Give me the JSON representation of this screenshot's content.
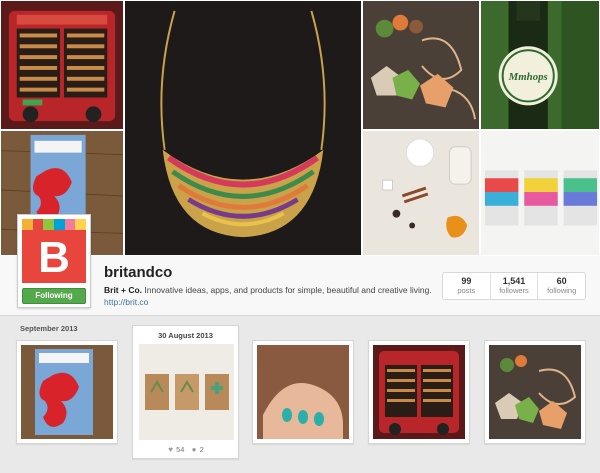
{
  "profile": {
    "username": "britandco",
    "verified_mark": "▫",
    "bio_name": "Brit + Co.",
    "bio_text": " Innovative ideas, apps, and products for simple, beautiful and creative living.",
    "link": "http://brit.co",
    "follow_label": "Following",
    "avatar_letter": "B",
    "avatar_stripe_colors": [
      "#f2b233",
      "#e8453c",
      "#8dc63f",
      "#00a3d9",
      "#f47b9a",
      "#ffd34e"
    ],
    "brand_color": "#e8453c",
    "follow_color": "#54a94c"
  },
  "stats": [
    {
      "value": "99",
      "label": "posts"
    },
    {
      "value": "1,541",
      "label": "followers"
    },
    {
      "value": "60",
      "label": "following"
    }
  ],
  "timeline": {
    "month_label": "September 2013",
    "featured": {
      "date": "30 August 2013",
      "likes": "54",
      "comments": "2"
    }
  },
  "cover_tiles": [
    {
      "icon": "vending-machine-photo"
    },
    {
      "icon": "pizza-cutter-photo"
    },
    {
      "icon": "necklace-photo"
    },
    {
      "icon": "geometric-beads-photo"
    },
    {
      "icon": "beer-bottle-photo"
    },
    {
      "icon": "ingredients-photo"
    },
    {
      "icon": "candles-photo"
    }
  ],
  "icons": {
    "like": "♥",
    "comment": "💬"
  }
}
